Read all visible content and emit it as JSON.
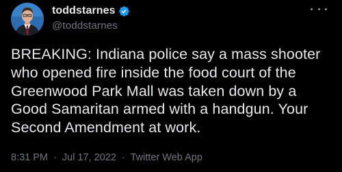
{
  "tweet": {
    "author": {
      "display_name": "toddstarnes",
      "handle": "@toddstarnes",
      "verified": true,
      "avatar_icon": "profile-photo"
    },
    "more_icon": "more-options-icon",
    "text": "BREAKING: Indiana police say a mass shooter who opened fire inside the food court of the Greenwood Park Mall was taken down by a Good Samaritan armed with a handgun. Your Second Amendment at work.",
    "meta": {
      "time": "8:31 PM",
      "separator": "·",
      "date": "Jul 17, 2022",
      "source": "Twitter Web App"
    }
  },
  "colors": {
    "background": "#000000",
    "text_primary": "#e7e9ea",
    "text_secondary": "#71767b",
    "verified_badge": "#1d9bf0"
  }
}
